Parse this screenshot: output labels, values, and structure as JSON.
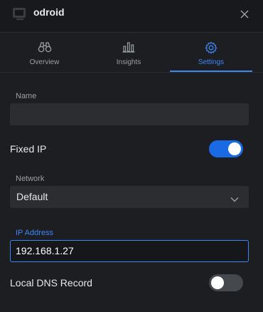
{
  "header": {
    "device_icon": "device-icon",
    "title": "odroid",
    "close_icon": "close-icon"
  },
  "tabs": [
    {
      "label": "Overview",
      "icon": "binoculars-icon",
      "active": false
    },
    {
      "label": "Insights",
      "icon": "bar-chart-icon",
      "active": false
    },
    {
      "label": "Settings",
      "icon": "gear-icon",
      "active": true
    }
  ],
  "settings": {
    "name": {
      "label": "Name",
      "value": ""
    },
    "fixed_ip": {
      "label": "Fixed IP",
      "enabled": true
    },
    "network": {
      "label": "Network",
      "value": "Default",
      "icon": "chevron-down-icon"
    },
    "ip_address": {
      "label": "IP Address",
      "value": "192.168.1.27"
    },
    "local_dns": {
      "label": "Local DNS Record",
      "enabled": false
    }
  },
  "colors": {
    "background": "#1c1e21",
    "accent": "#3f86f5",
    "toggle_on": "#1a6ae6",
    "toggle_off": "#45484d",
    "input_bg": "#2b2d31"
  }
}
